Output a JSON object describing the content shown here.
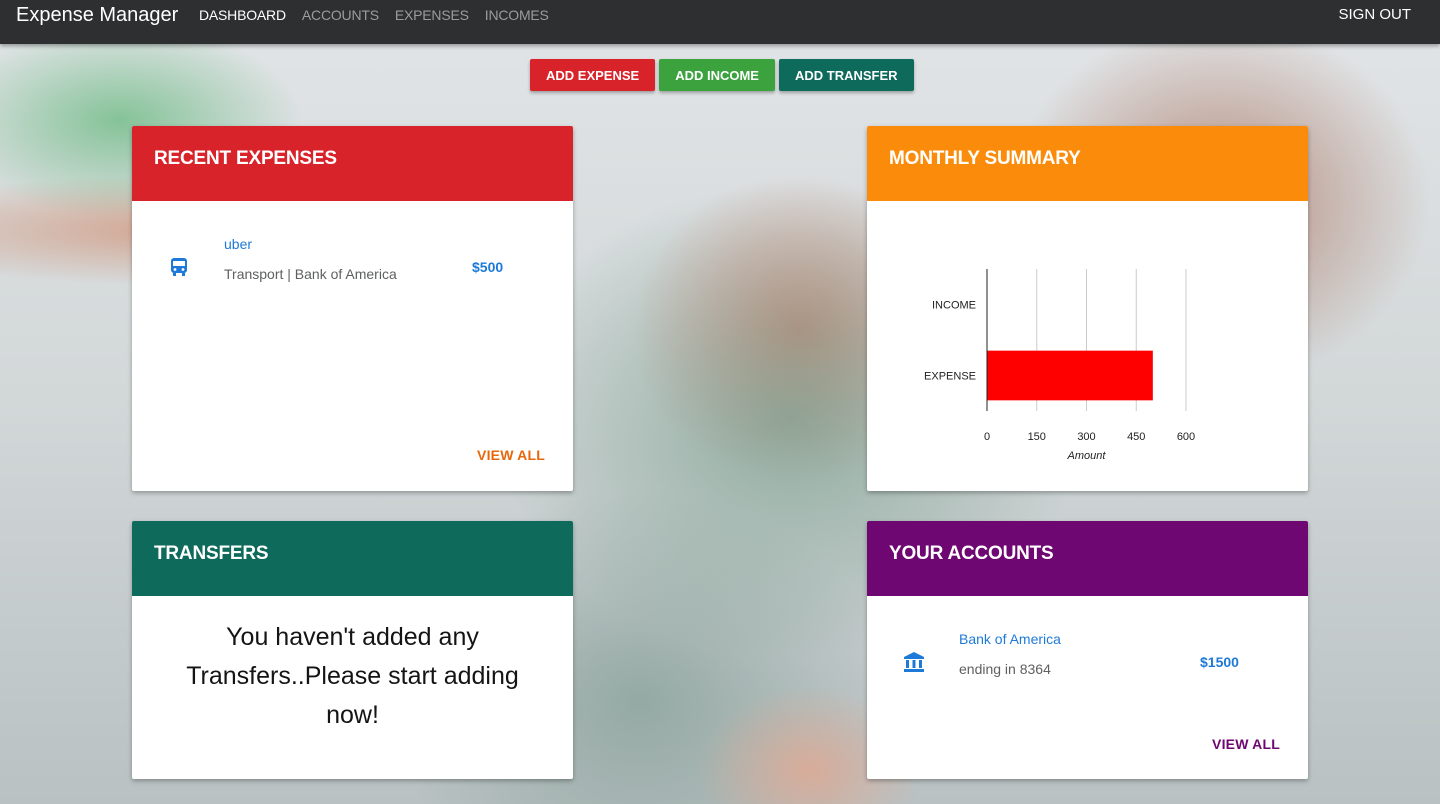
{
  "navbar": {
    "brand": "Expense Manager",
    "links": [
      "DASHBOARD",
      "ACCOUNTS",
      "EXPENSES",
      "INCOMES"
    ],
    "active": "DASHBOARD",
    "signout": "SIGN OUT"
  },
  "actions": {
    "add_expense": "ADD EXPENSE",
    "add_income": "ADD INCOME",
    "add_transfer": "ADD TRANSFER"
  },
  "colors": {
    "expense_red": "#d9232b",
    "income_green": "#3ba23e",
    "transfer_teal": "#0e6a5b",
    "summary_orange": "#fb8c0b",
    "accounts_purple": "#6e0771",
    "link_blue": "#1e7ad8",
    "view_all_orange": "#e8670b",
    "view_all_purple": "#6e0771",
    "bar_red": "#ff0000"
  },
  "recent_expenses": {
    "title": "RECENT EXPENSES",
    "items": [
      {
        "icon": "bus-icon",
        "title": "uber",
        "subtitle": "Transport | Bank of America",
        "amount": "$500"
      }
    ],
    "view_all": "VIEW ALL"
  },
  "monthly_summary": {
    "title": "MONTHLY SUMMARY"
  },
  "chart_data": {
    "type": "bar",
    "orientation": "horizontal",
    "categories": [
      "INCOME",
      "EXPENSE"
    ],
    "values": [
      0,
      500
    ],
    "xlabel": "Amount",
    "xlim": [
      0,
      600
    ],
    "xticks": [
      0,
      150,
      300,
      450,
      600
    ],
    "grid": true,
    "legend": "none"
  },
  "transfers": {
    "title": "TRANSFERS",
    "empty_message": "You haven't added any Transfers..Please start adding now!"
  },
  "accounts": {
    "title": "YOUR ACCOUNTS",
    "items": [
      {
        "icon": "bank-icon",
        "title": "Bank of America",
        "subtitle": "ending in 8364",
        "amount": "$1500"
      }
    ],
    "view_all": "VIEW ALL"
  }
}
